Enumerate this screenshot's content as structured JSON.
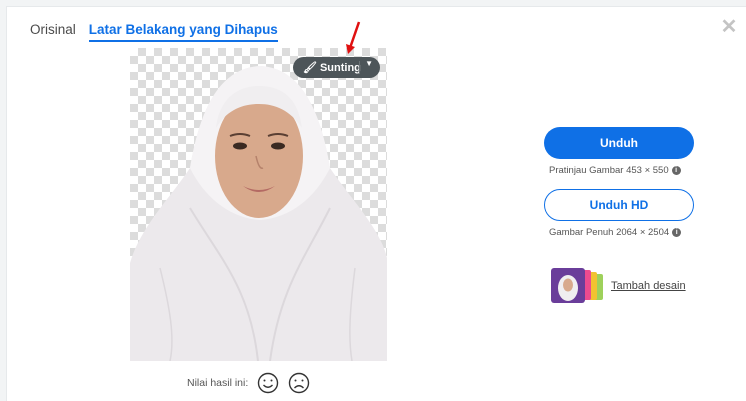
{
  "tabs": [
    {
      "label": "Orisinal"
    },
    {
      "label": "Latar Belakang yang Dihapus"
    }
  ],
  "close_icon": "close-icon",
  "photo": {
    "edit_label": "Sunting",
    "edit_icon": "brush-icon",
    "caret_icon": "chevron-down-icon"
  },
  "rating": {
    "label": "Nilai hasil ini:",
    "positive_icon": "smile-icon",
    "negative_icon": "frown-icon"
  },
  "download": {
    "label": "Unduh",
    "preview_text": "Pratinjau Gambar 453 × 550"
  },
  "download_hd": {
    "label": "Unduh HD",
    "full_text": "Gambar Penuh 2064 × 2504"
  },
  "design": {
    "label": "Tambah desain"
  },
  "colors": {
    "accent": "#0f70e6",
    "edit_button": "#4d5559",
    "arrow": "#e01010"
  }
}
